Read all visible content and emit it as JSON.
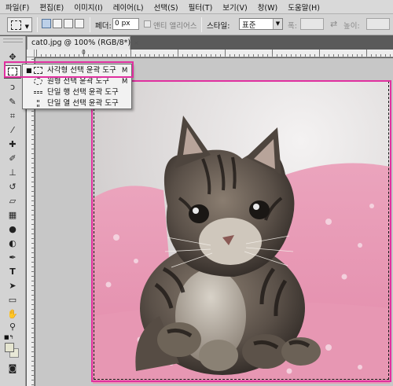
{
  "menubar": [
    "파일(F)",
    "편집(E)",
    "이미지(I)",
    "레이어(L)",
    "선택(S)",
    "필터(T)",
    "보기(V)",
    "창(W)",
    "도움말(H)"
  ],
  "options": {
    "feather_label": "페더:",
    "feather_value": "0 px",
    "antialias_label": "앤티 앨리어스",
    "style_label": "스타일:",
    "style_value": "표준",
    "width_label": "폭:",
    "swap_icon": "⇄",
    "height_label": "높이:"
  },
  "document": {
    "tab_title": "cat0.jpg @ 100% (RGB/8*)",
    "close": "×",
    "ruler_zero": "0"
  },
  "flyout": {
    "items": [
      {
        "label": "사각형 선택 윤곽 도구",
        "key": "M",
        "icon": "rect-marquee-icon",
        "active": true
      },
      {
        "label": "원형 선택 윤곽 도구",
        "key": "M",
        "icon": "elliptical-marquee-icon",
        "active": false
      },
      {
        "label": "단일 행 선택 윤곽 도구",
        "key": "",
        "icon": "single-row-marquee-icon",
        "active": false
      },
      {
        "label": "단일 열 선택 윤곽 도구",
        "key": "",
        "icon": "single-column-marquee-icon",
        "active": false
      }
    ],
    "bullet": "■"
  },
  "colors": {
    "highlight": "#e0309f",
    "foreground": "#e5e5d0",
    "background": "#e8e8d6"
  },
  "tools": [
    {
      "name": "move-tool",
      "glyph": "✥"
    },
    {
      "name": "marquee-tool",
      "glyph": ""
    },
    {
      "name": "lasso-tool",
      "glyph": "ↄ"
    },
    {
      "name": "quick-selection-tool",
      "glyph": "✎"
    },
    {
      "name": "crop-tool",
      "glyph": "⌗"
    },
    {
      "name": "eyedropper-tool",
      "glyph": "⁄"
    },
    {
      "name": "spot-healing-tool",
      "glyph": "✚"
    },
    {
      "name": "brush-tool",
      "glyph": "✐"
    },
    {
      "name": "clone-stamp-tool",
      "glyph": "⊥"
    },
    {
      "name": "history-brush-tool",
      "glyph": "↺"
    },
    {
      "name": "eraser-tool",
      "glyph": "▱"
    },
    {
      "name": "gradient-tool",
      "glyph": "▦"
    },
    {
      "name": "blur-tool",
      "glyph": "●"
    },
    {
      "name": "dodge-tool",
      "glyph": "◐"
    },
    {
      "name": "pen-tool",
      "glyph": "✒"
    },
    {
      "name": "type-tool",
      "glyph": "T"
    },
    {
      "name": "path-selection-tool",
      "glyph": "➤"
    },
    {
      "name": "shape-tool",
      "glyph": "▭"
    },
    {
      "name": "hand-tool",
      "glyph": "✋"
    },
    {
      "name": "zoom-tool",
      "glyph": "⚲"
    },
    {
      "name": "quick-mask-tool",
      "glyph": "◙"
    }
  ]
}
